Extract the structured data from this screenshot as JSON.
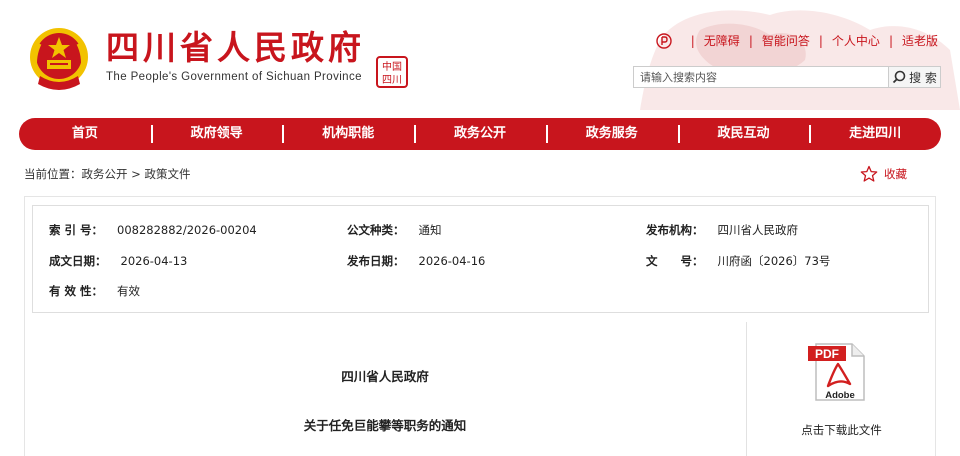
{
  "header": {
    "title": "四川省人民政府",
    "subtitle": "The People's Government of Sichuan Province",
    "seal_text": "中国四川",
    "top_links": [
      "无障碍",
      "智能问答",
      "个人中心",
      "适老版"
    ],
    "search": {
      "placeholder": "请输入搜索内容",
      "button_label": "搜 索"
    }
  },
  "nav": {
    "items": [
      "首页",
      "政府领导",
      "机构职能",
      "政务公开",
      "政务服务",
      "政民互动",
      "走进四川"
    ]
  },
  "breadcrumb": {
    "text": "当前位置：政务公开 > 政策文件"
  },
  "favorite": {
    "label": "收藏"
  },
  "meta": {
    "index_no": {
      "label": "索 引 号：",
      "value": "008282882/2026-00204"
    },
    "doc_type": {
      "label": "公文种类：",
      "value": "通知"
    },
    "issuer": {
      "label": "发布机构：",
      "value": "四川省人民政府"
    },
    "created_date": {
      "label": "成文日期：",
      "value": "2026-04-13"
    },
    "publish_date": {
      "label": "发布日期：",
      "value": "2026-04-16"
    },
    "doc_no": {
      "label": "文　　号：",
      "value": "川府函〔2026〕73号"
    },
    "validity": {
      "label": "有 效 性：",
      "value": "有效"
    }
  },
  "document": {
    "issuer": "四川省人民政府",
    "title": "关于任免巨能攀等职务的通知"
  },
  "download": {
    "pdf_label": "PDF",
    "brand": "Adobe",
    "label": "点击下载此文件"
  },
  "colors": {
    "brand_red": "#c8151d",
    "gold": "#f2c200"
  }
}
